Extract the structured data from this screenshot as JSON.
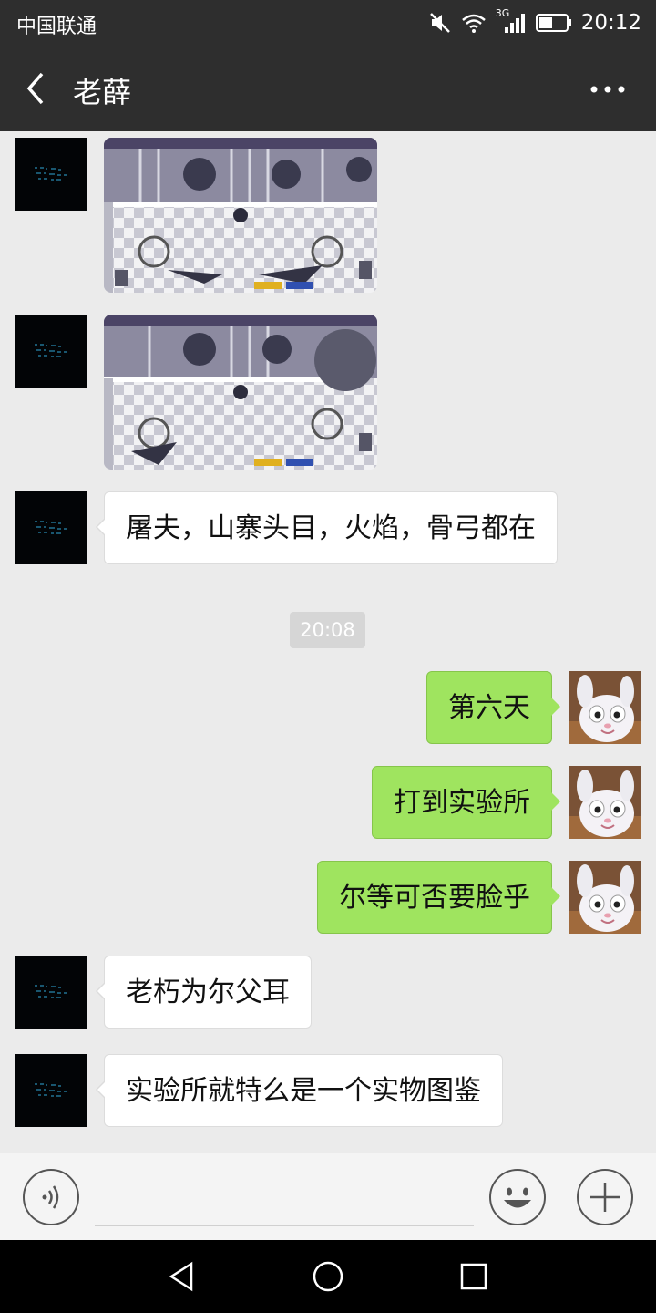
{
  "status_bar": {
    "carrier": "中国联通",
    "network": "3G",
    "time": "20:12"
  },
  "header": {
    "title": "老薛",
    "back_icon": "chevron-left-icon",
    "more_icon": "more-horizontal-icon"
  },
  "messages": [
    {
      "side": "left",
      "type": "image",
      "description_icon": "game-screenshot-image"
    },
    {
      "side": "left",
      "type": "image",
      "description_icon": "game-screenshot-image"
    },
    {
      "side": "left",
      "type": "text",
      "text": "屠夫，山寨头目，火焰，骨弓都在"
    },
    {
      "type": "timestamp",
      "text": "20:08"
    },
    {
      "side": "right",
      "type": "text",
      "text": "第六天"
    },
    {
      "side": "right",
      "type": "text",
      "text": "打到实验所"
    },
    {
      "side": "right",
      "type": "text",
      "text": "尔等可否要脸乎"
    },
    {
      "side": "left",
      "type": "text",
      "text": "老朽为尔父耳"
    },
    {
      "side": "left",
      "type": "text",
      "text": "实验所就特么是一个实物图鉴"
    }
  ],
  "input_bar": {
    "voice_icon": "voice-icon",
    "input_value": "",
    "emoji_icon": "emoji-icon",
    "plus_icon": "plus-icon"
  },
  "colors": {
    "bar_dark": "#2e2e2e",
    "chat_bg": "#ebebeb",
    "sent_bubble": "#9fe45f",
    "received_bubble": "#ffffff"
  }
}
